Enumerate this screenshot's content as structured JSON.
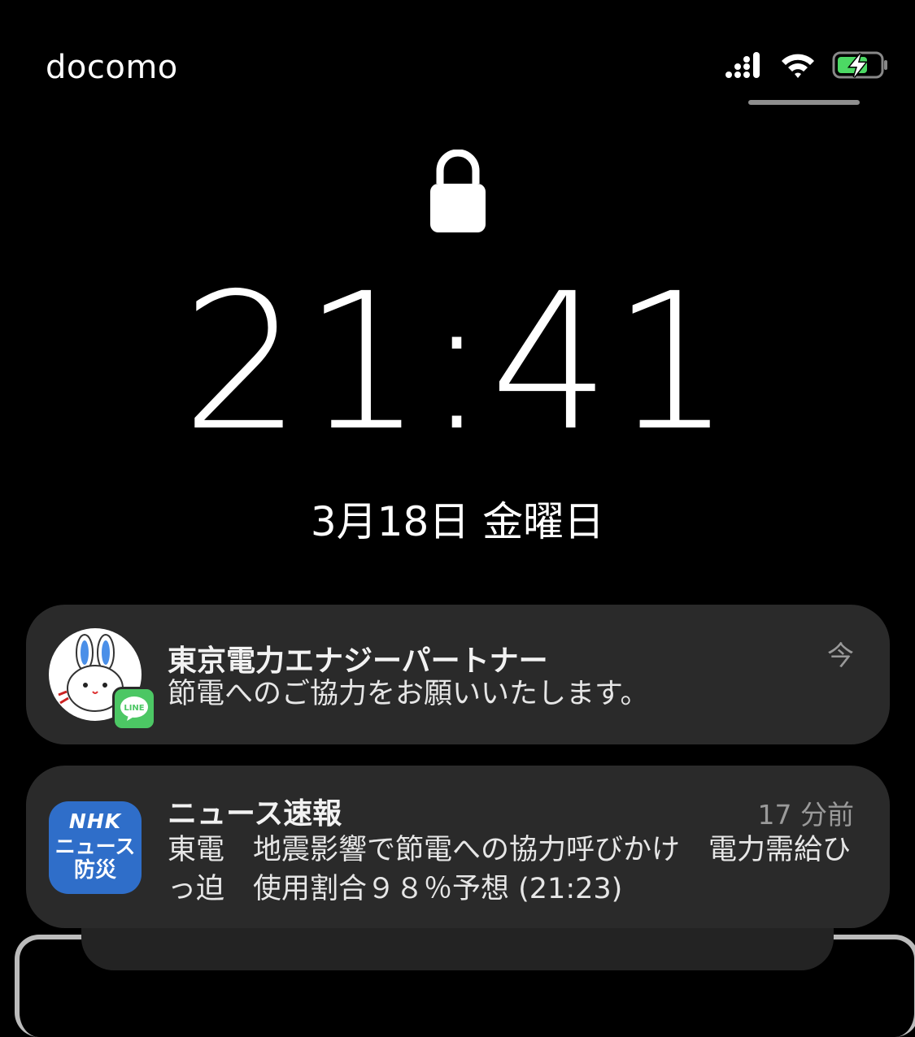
{
  "status_bar": {
    "carrier": "docomo",
    "icons": [
      "cellular-signal-icon",
      "wifi-icon",
      "battery-charging-icon"
    ],
    "battery_color": "#4cd964"
  },
  "lock_screen": {
    "lock_icon": "lock-icon",
    "time": "21:41",
    "date": "3月18日 金曜日"
  },
  "notifications": [
    {
      "app_icon": "rabbit-avatar-icon",
      "badge_icon": "line-app-icon",
      "badge_text": "LINE",
      "badge_color": "#4cc764",
      "title": "東京電力エナジーパートナー",
      "time": "今",
      "body": "節電へのご協力をお願いいたします。"
    },
    {
      "app_icon": "nhk-news-bousai-icon",
      "app_icon_lines": [
        "NHK",
        "ニュース",
        "防災"
      ],
      "app_icon_color": "#2f6ec9",
      "title": "ニュース速報",
      "time": "17 分前",
      "body": "東電　地震影響で節電への協力呼びかけ　電力需給ひっ迫　使用割合９８％予想 (21:23)"
    }
  ]
}
